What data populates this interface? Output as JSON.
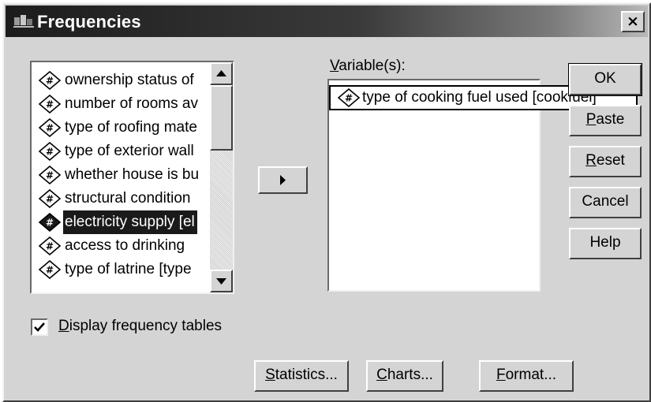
{
  "window": {
    "title": "Frequencies",
    "close_glyph": "×"
  },
  "source_list": {
    "items": [
      {
        "label": "ownership status of",
        "icon": "numeric-variable-icon",
        "selected": false
      },
      {
        "label": "number of rooms av",
        "icon": "numeric-variable-icon",
        "selected": false
      },
      {
        "label": "type of roofing mate",
        "icon": "numeric-variable-icon",
        "selected": false
      },
      {
        "label": "type of exterior wall",
        "icon": "numeric-variable-icon",
        "selected": false
      },
      {
        "label": "whether house is bu",
        "icon": "numeric-variable-icon",
        "selected": false
      },
      {
        "label": "structural condition",
        "icon": "numeric-variable-icon",
        "selected": false
      },
      {
        "label": "electricity supply [el",
        "icon": "numeric-variable-icon",
        "selected": true
      },
      {
        "label": "access to drinking",
        "icon": "numeric-variable-icon",
        "selected": false
      },
      {
        "label": "type of latrine [type",
        "icon": "numeric-variable-icon",
        "selected": false
      }
    ]
  },
  "variables": {
    "label_prefix": "V",
    "label_rest": "ariable(s):",
    "items": [
      {
        "label": "type of cooking fuel used [cookfuel]",
        "icon": "numeric-variable-icon"
      }
    ]
  },
  "buttons": {
    "ok": "OK",
    "paste_u": "P",
    "paste_rest": "aste",
    "reset_u": "R",
    "reset_rest": "eset",
    "cancel": "Cancel",
    "help": "Help",
    "statistics_u": "S",
    "statistics_rest": "tatistics...",
    "charts_u": "C",
    "charts_rest": "harts...",
    "format_u": "F",
    "format_rest": "ormat..."
  },
  "options": {
    "display_tables_u": "D",
    "display_tables_rest": "isplay frequency tables",
    "display_tables_checked": true
  }
}
